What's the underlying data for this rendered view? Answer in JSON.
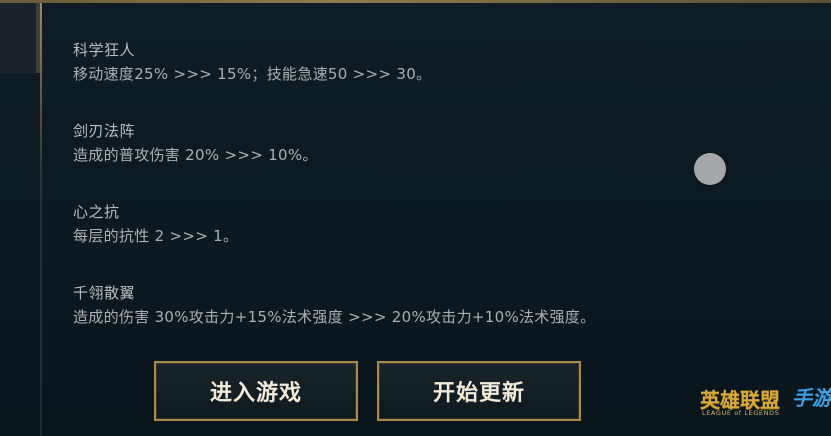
{
  "patch_notes": [
    {
      "title": "科学狂人",
      "body": "移动速度25%  >>> 15%；技能急速50 >>> 30。"
    },
    {
      "title": "剑刃法阵",
      "body": "造成的普攻伤害 20% >>> 10%。"
    },
    {
      "title": "心之抗",
      "body": "每层的抗性 2 >>> 1。"
    },
    {
      "title": "千翎散翼",
      "body": "造成的伤害 30%攻击力+15%法术强度 >>> 20%攻击力+10%法术强度。"
    }
  ],
  "buttons": {
    "enter_game": "进入游戏",
    "start_update": "开始更新"
  },
  "logo": {
    "main_text": "英雄联盟",
    "brush_text": "手游",
    "sub_text": "LEAGUE of LEGENDS"
  },
  "colors": {
    "background": "#0e1c25",
    "gold_border": "#a88a4a",
    "button_text": "#f1ead8",
    "note_text": "#aab0b4",
    "logo_gold": "#d8a93c",
    "logo_blue": "#3da0e6"
  }
}
